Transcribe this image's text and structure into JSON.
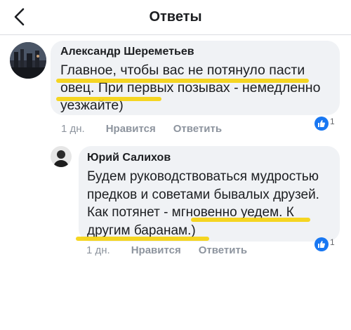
{
  "header": {
    "title": "Ответы",
    "back_icon": "chevron-left-icon"
  },
  "comments": [
    {
      "author": "Александр Шереметьев",
      "lines": [
        "Главное, чтобы вас не потянуло пасти",
        "овец. При первых позывах - немедленно",
        "уезжайте)"
      ],
      "age": "1 дн.",
      "like_label": "Нравится",
      "reply_label": "Ответить",
      "reactions": "1"
    },
    {
      "author": "Юрий Салихов",
      "lines": [
        "Будем руководствоваться мудростью",
        "предков и советами бывалых друзей.",
        "Как потянет - мгновенно уедем. К",
        "другим баранам.)"
      ],
      "age": "1 дн.",
      "like_label": "Нравится",
      "reply_label": "Ответить",
      "reactions": "1"
    }
  ],
  "colors": {
    "highlight": "#f5d10a",
    "like_blue": "#1877f2",
    "bubble": "#f0f2f5",
    "meta_gray": "#8d949e"
  }
}
